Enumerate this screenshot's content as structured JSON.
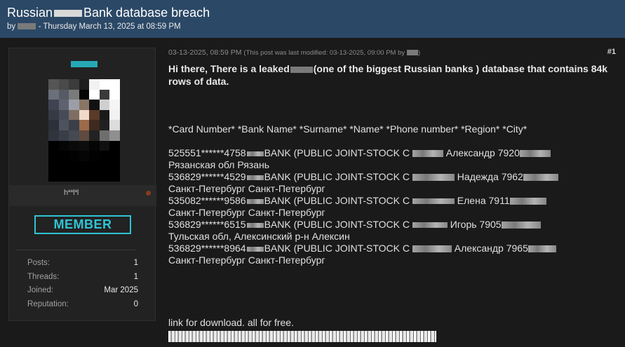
{
  "thread": {
    "title_prefix": "Russian",
    "title_suffix": "Bank database breach",
    "meta_by": "by",
    "meta_date": "- Thursday March 13, 2025 at 08:59 PM"
  },
  "user": {
    "username": "h**l*l",
    "rank": "MEMBER",
    "stats": [
      {
        "label": "Posts:",
        "value": "1"
      },
      {
        "label": "Threads:",
        "value": "1"
      },
      {
        "label": "Joined:",
        "value": "Mar 2025"
      },
      {
        "label": "Reputation:",
        "value": "0"
      }
    ]
  },
  "post": {
    "date": "03-13-2025, 08:59 PM",
    "modified_note": "(This post was last modified: 03-13-2025, 09:00 PM by",
    "number": "#1",
    "intro_a": "Hi there, There is a leaked",
    "intro_b": "(one of the biggest Russian banks ) database that contains 84k rows of data.",
    "fields_line": "*Card Number* *Bank Name* *Surname* *Name* *Phone number* *Region* *City*",
    "records": [
      {
        "card": "525551******4758",
        "bank": "BANK (PUBLIC JOINT-STOCK C",
        "name": "Александр 7920",
        "region_city": "Рязанская обл Рязань"
      },
      {
        "card": "536829******4529",
        "bank": "BANK (PUBLIC JOINT-STOCK C",
        "name": "Надежда 7962",
        "region_city": "Санкт-Петербург Санкт-Петербург"
      },
      {
        "card": "535082******9586",
        "bank": "BANK (PUBLIC JOINT-STOCK C",
        "name": "Елена 7911",
        "region_city": "Санкт-Петербург Санкт-Петербург"
      },
      {
        "card": "536829******6515",
        "bank": "BANK (PUBLIC JOINT-STOCK C",
        "name": "Игорь 7905",
        "region_city": "Тульская обл, Алексинский р-н Алексин"
      },
      {
        "card": "536829******8964",
        "bank": "BANK (PUBLIC JOINT-STOCK C",
        "name": "Александр 7965",
        "region_city": "Санкт-Петербург Санкт-Петербург"
      }
    ],
    "download_text": "link for download. all for free."
  },
  "colors": {
    "header_bg": "#2b4866",
    "rank_accent": "#2fc4d4",
    "page_bg": "#1a1a1a"
  }
}
